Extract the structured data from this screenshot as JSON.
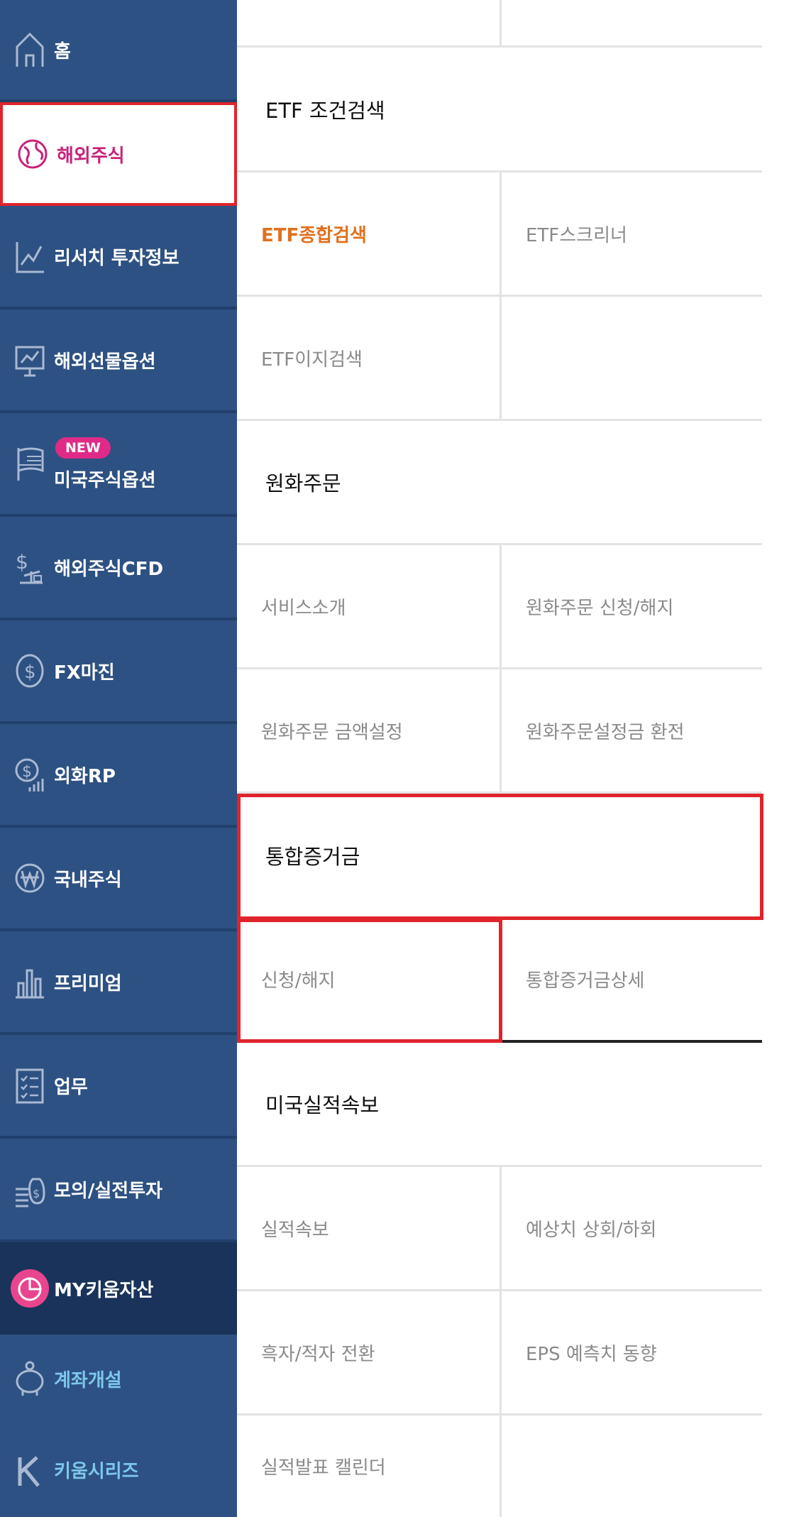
{
  "sidebar": {
    "items": [
      {
        "label": "홈",
        "icon": "home-icon"
      },
      {
        "label": "해외주식",
        "icon": "globe-icon",
        "active": true
      },
      {
        "label": "리서치 투자정보",
        "icon": "line-chart-icon"
      },
      {
        "label": "해외선물옵션",
        "icon": "monitor-chart-icon"
      },
      {
        "label": "미국주식옵션",
        "icon": "us-flag-icon",
        "badge": "NEW"
      },
      {
        "label": "해외주식CFD",
        "icon": "dollar-scale-icon"
      },
      {
        "label": "FX마진",
        "icon": "dollar-coin-icon"
      },
      {
        "label": "외화RP",
        "icon": "dollar-growth-icon"
      },
      {
        "label": "국내주식",
        "icon": "won-coin-icon"
      },
      {
        "label": "프리미엄",
        "icon": "bar-chart-icon"
      },
      {
        "label": "업무",
        "icon": "checklist-icon"
      },
      {
        "label": "모의/실전투자",
        "icon": "money-bag-icon"
      },
      {
        "label": "MY키움자산",
        "icon": "pie-chart-icon"
      },
      {
        "label": "계좌개설",
        "icon": "piggy-bank-icon"
      },
      {
        "label": "키움시리즈",
        "icon": "kiwoom-k-icon"
      }
    ]
  },
  "content": {
    "etf_section": {
      "title": "ETF 조건검색",
      "items": [
        "ETF종합검색",
        "ETF스크리너",
        "ETF이지검색"
      ]
    },
    "won_order_section": {
      "title": "원화주문",
      "items": [
        "서비스소개",
        "원화주문 신청/해지",
        "원화주문 금액설정",
        "원화주문설정금 환전"
      ]
    },
    "margin_section": {
      "title": "통합증거금",
      "items": [
        "신청/해지",
        "통합증거금상세"
      ]
    },
    "earnings_section": {
      "title": "미국실적속보",
      "items": [
        "실적속보",
        "예상치 상회/하회",
        "흑자/적자 전환",
        "EPS 예측치 동향",
        "실적발표 캘린더"
      ]
    }
  },
  "colors": {
    "sidebar_bg": "#2d5182",
    "sidebar_dark": "#19335a",
    "active_text": "#c8227a",
    "highlight_border": "#e0242b",
    "accent_orange": "#e0701f",
    "badge_pink": "#e02a87",
    "cyan_text": "#7dc7ea"
  }
}
